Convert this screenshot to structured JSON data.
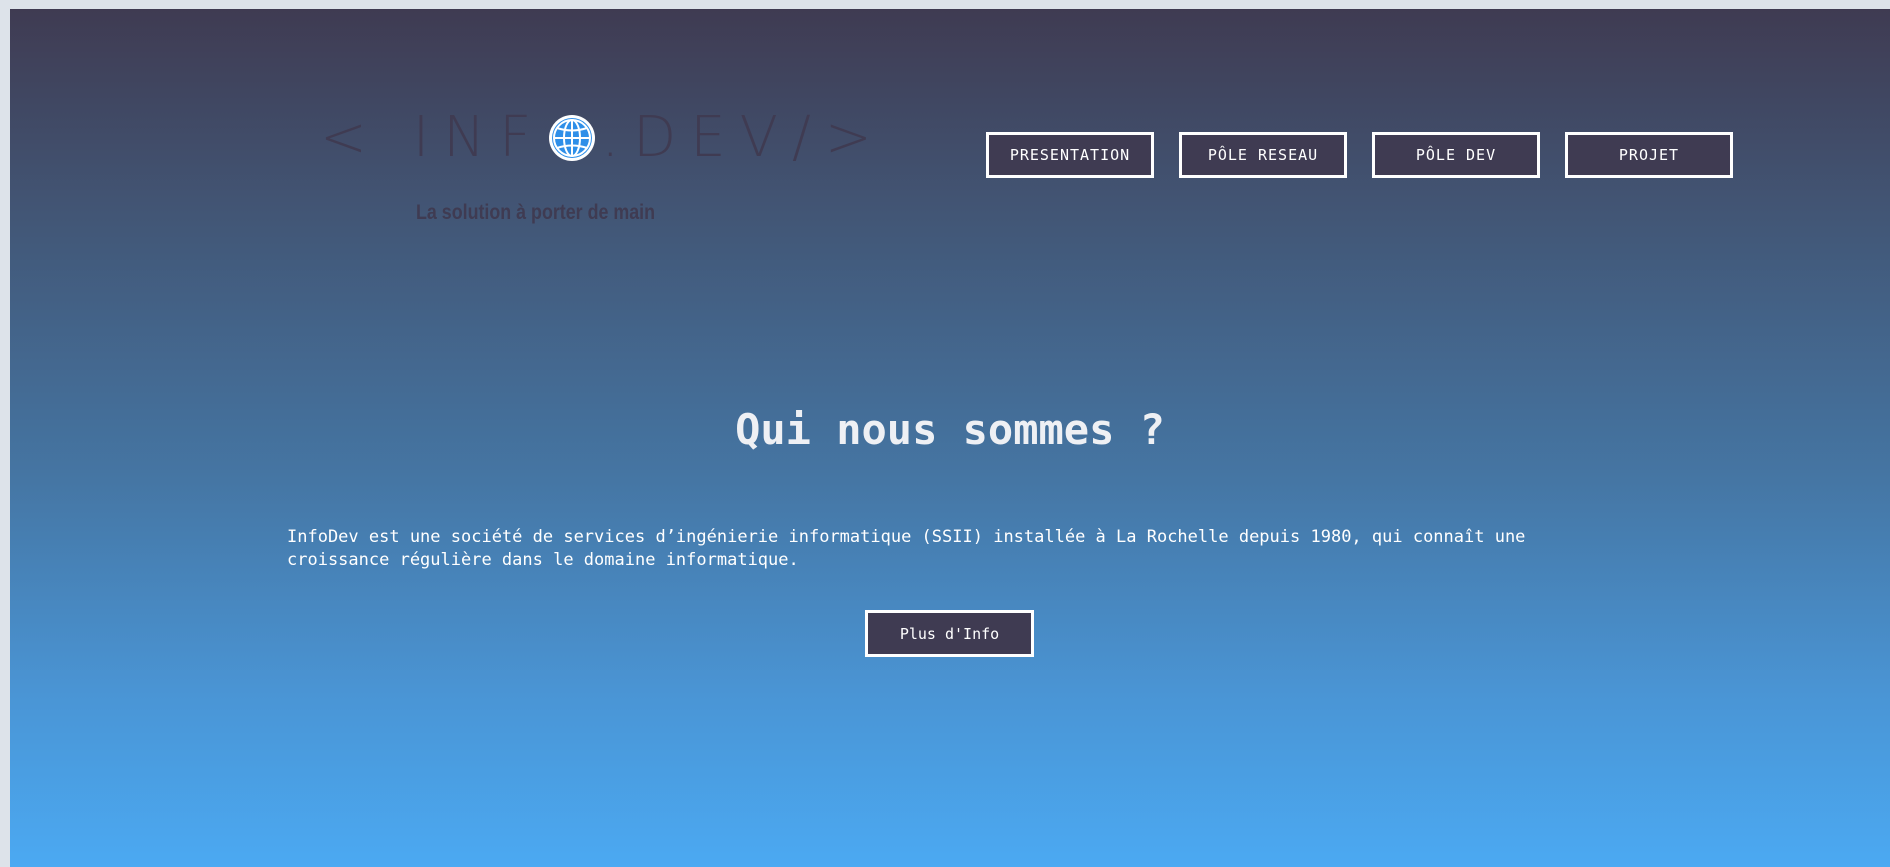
{
  "logo": {
    "text_left": "< INF",
    "text_right": ".DEV/>",
    "tagline": "La solution à porter de main",
    "icon": "globe-icon"
  },
  "nav": {
    "items": [
      {
        "label": "PRESENTATION"
      },
      {
        "label": "PÔLE RESEAU"
      },
      {
        "label": "PÔLE DEV"
      },
      {
        "label": "PROJET"
      }
    ]
  },
  "hero": {
    "title": "Qui nous sommes ?",
    "text": "InfoDev est une société de services d’ingénierie informatique (SSII) installée à La Rochelle depuis 1980, qui connaît une croissance régulière dans le domaine informatique.",
    "button_label": "Plus d'Info"
  },
  "colors": {
    "dark": "#3f3b52",
    "gradient_top": "#3f3b52",
    "gradient_bottom": "#4ba9f2",
    "globe": "#2f8fe8"
  }
}
